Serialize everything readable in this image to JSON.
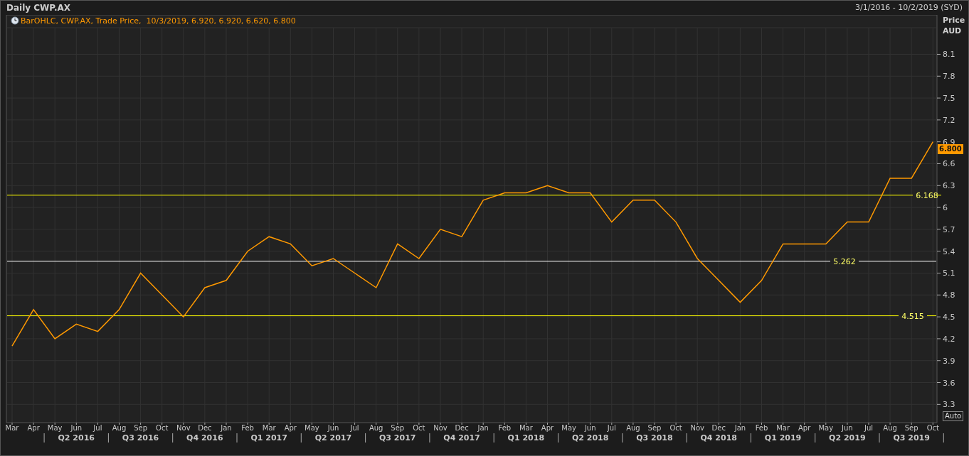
{
  "window": {
    "title": "Daily CWP.AX",
    "date_range": "3/1/2016 - 10/2/2019 (SYD)"
  },
  "legend": "BarOHLC, CWP.AX, Trade Price,  10/3/2019, 6.920, 6.920, 6.620, 6.800",
  "axis": {
    "title_lines": [
      "Price",
      "AUD"
    ],
    "last_price": "6.800",
    "auto_button": "Auto",
    "quarters": [
      "Q2 2016",
      "Q3 2016",
      "Q4 2016",
      "Q1 2017",
      "Q2 2017",
      "Q3 2017",
      "Q4 2017",
      "Q1 2018",
      "Q2 2018",
      "Q3 2018",
      "Q4 2018",
      "Q1 2019",
      "Q2 2019",
      "Q3 2019"
    ]
  },
  "chart_data": {
    "type": "line",
    "categories": [
      "Mar",
      "Apr",
      "May",
      "Jun",
      "Jul",
      "Aug",
      "Sep",
      "Oct",
      "Nov",
      "Dec",
      "Jan",
      "Feb",
      "Mar",
      "Apr",
      "May",
      "Jun",
      "Jul",
      "Aug",
      "Sep",
      "Oct",
      "Nov",
      "Dec",
      "Jan",
      "Feb",
      "Mar",
      "Apr",
      "May",
      "Jun",
      "Jul",
      "Aug",
      "Sep",
      "Oct",
      "Nov",
      "Dec",
      "Jan",
      "Feb",
      "Mar",
      "Apr",
      "May",
      "Jun",
      "Jul",
      "Aug",
      "Sep",
      "Oct"
    ],
    "series": [
      {
        "color": "#ff9900",
        "values": [
          4.1,
          4.6,
          4.2,
          4.4,
          4.3,
          4.6,
          5.1,
          4.8,
          4.5,
          4.9,
          5.0,
          5.4,
          5.6,
          5.5,
          5.2,
          5.3,
          5.1,
          4.9,
          5.5,
          5.3,
          5.7,
          5.6,
          6.1,
          6.2,
          6.2,
          6.3,
          6.2,
          6.2,
          5.8,
          6.1,
          6.1,
          5.8,
          5.3,
          5.0,
          4.7,
          5.0,
          5.5,
          5.5,
          5.5,
          5.8,
          5.8,
          6.4,
          6.4,
          6.9
        ]
      }
    ],
    "ylim": [
      3.05,
      8.64
    ],
    "grid": true,
    "yticks": [
      {
        "value": 8.1,
        "label": "8.1"
      },
      {
        "value": 7.8,
        "label": "7.8"
      },
      {
        "value": 7.5,
        "label": "7.5"
      },
      {
        "value": 7.2,
        "label": "7.2"
      },
      {
        "value": 6.9,
        "label": "6.9"
      },
      {
        "value": 6.6,
        "label": "6.6"
      },
      {
        "value": 6.3,
        "label": "6.3"
      },
      {
        "value": 6.0,
        "label": "6"
      },
      {
        "value": 5.7,
        "label": "5.7"
      },
      {
        "value": 5.4,
        "label": "5.4"
      },
      {
        "value": 5.1,
        "label": "5.1"
      },
      {
        "value": 4.8,
        "label": "4.8"
      },
      {
        "value": 4.5,
        "label": "4.5"
      },
      {
        "value": 4.2,
        "label": "4.2"
      },
      {
        "value": 3.9,
        "label": "3.9"
      },
      {
        "value": 3.6,
        "label": "3.6"
      },
      {
        "value": 3.3,
        "label": "3.3"
      }
    ],
    "ref_lines": [
      {
        "axis": "y",
        "value": 6.168,
        "label": "6.168",
        "color": "#ffff00"
      },
      {
        "axis": "y",
        "value": 5.262,
        "label": "5.262",
        "color": "#ffffff"
      },
      {
        "axis": "y",
        "value": 4.515,
        "label": "4.515",
        "color": "#ffff00"
      }
    ]
  }
}
